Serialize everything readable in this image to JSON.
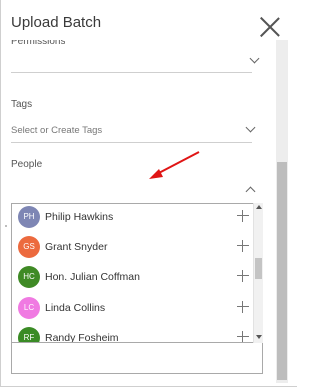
{
  "dialog": {
    "title": "Upload Batch"
  },
  "permissions": {
    "label": "Permissions"
  },
  "tags": {
    "label": "Tags",
    "placeholder": "Select or Create Tags"
  },
  "people": {
    "label": "People",
    "items": [
      {
        "initials": "PH",
        "name": "Philip Hawkins",
        "color": "#7e86b4"
      },
      {
        "initials": "GS",
        "name": "Grant Snyder",
        "color": "#ec6a3e"
      },
      {
        "initials": "HC",
        "name": "Hon. Julian Coffman",
        "color": "#3f8a25"
      },
      {
        "initials": "LC",
        "name": "Linda Collins",
        "color": "#f07ae2"
      },
      {
        "initials": "RF",
        "name": "Randy Fosheim",
        "color": "#3a8b25"
      }
    ]
  },
  "annotation": {
    "arrow_color": "#e01515"
  }
}
